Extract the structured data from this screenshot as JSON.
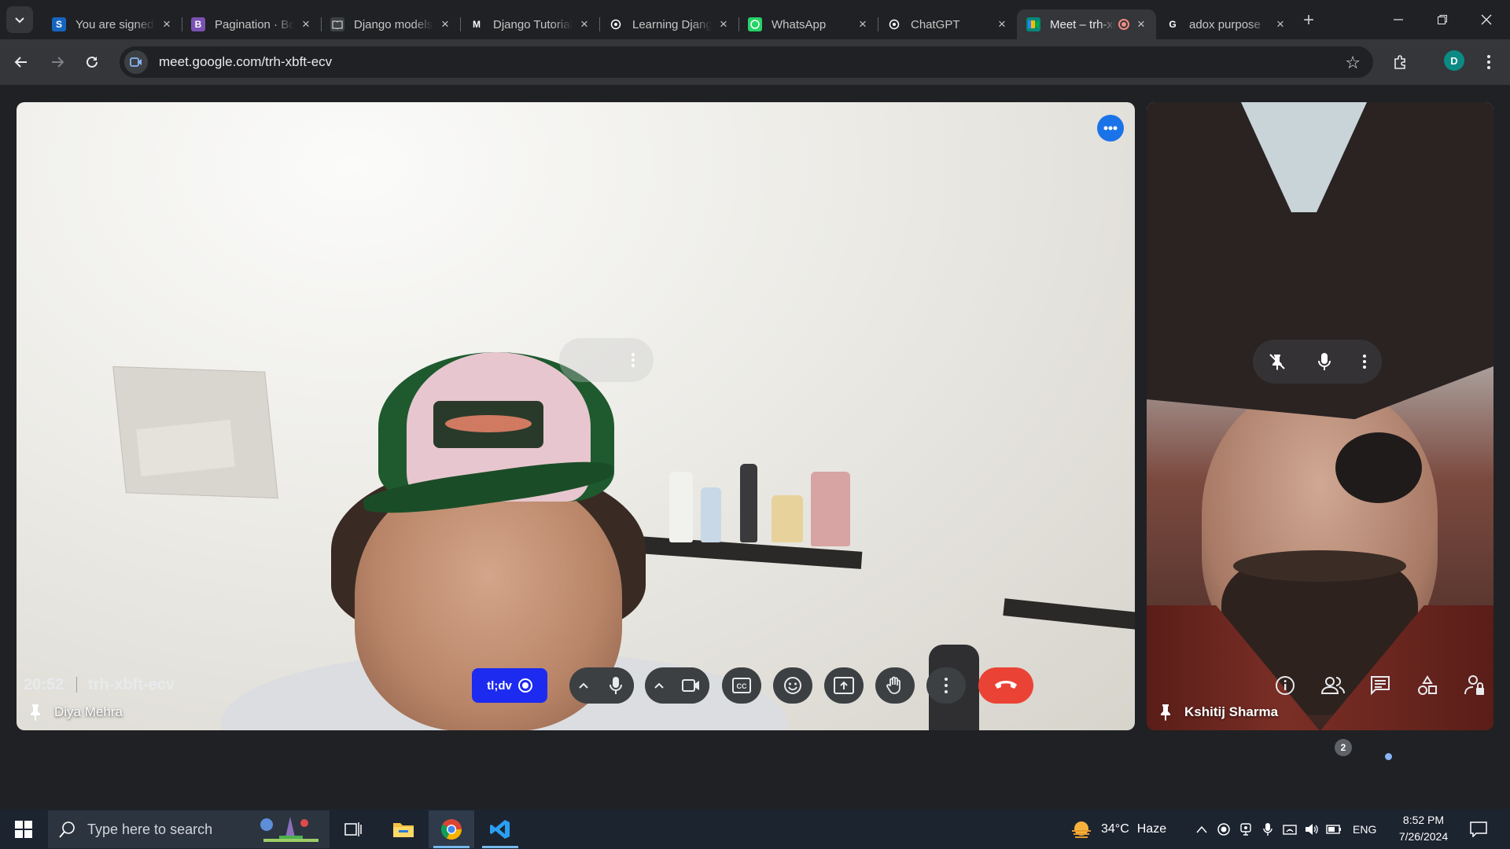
{
  "browser": {
    "tabs": [
      {
        "title": "You are signed in",
        "favicon": "S",
        "color": "#1565c0",
        "active": false
      },
      {
        "title": "Pagination · Bootstrap",
        "favicon": "B",
        "color": "#7952b3",
        "active": false
      },
      {
        "title": "Django models",
        "favicon": "book-icon",
        "color": "#3c4043",
        "active": false
      },
      {
        "title": "Django Tutorial",
        "favicon": "M",
        "color": "#202124",
        "active": false
      },
      {
        "title": "Learning Django",
        "favicon": "openai-icon",
        "color": "#202124",
        "active": false
      },
      {
        "title": "WhatsApp",
        "favicon": "whatsapp-icon",
        "color": "#25d366",
        "active": false
      },
      {
        "title": "ChatGPT",
        "favicon": "openai-icon",
        "color": "#202124",
        "active": false
      },
      {
        "title": "Meet – trh-xbft-ecv",
        "favicon": "meet-icon",
        "color": "#00897b",
        "active": true
      },
      {
        "title": "adox purpose",
        "favicon": "G",
        "color": "#202124",
        "active": false
      }
    ],
    "url": "meet.google.com/trh-xbft-ecv",
    "profile_initial": "D"
  },
  "meet": {
    "participants": [
      {
        "name": "Diya Mehra"
      },
      {
        "name": "Kshitij Sharma"
      }
    ],
    "time": "20:52",
    "meeting_code": "trh-xbft-ecv",
    "tldv_label": "tl;dv",
    "people_count": "2",
    "colors": {
      "hangup": "#ea4335",
      "accent": "#1a73e8",
      "tldv": "#1d2bf0"
    }
  },
  "taskbar": {
    "search_placeholder": "Type here to search",
    "weather_temp": "34°C",
    "weather_desc": "Haze",
    "language": "ENG",
    "time": "8:52 PM",
    "date": "7/26/2024"
  }
}
